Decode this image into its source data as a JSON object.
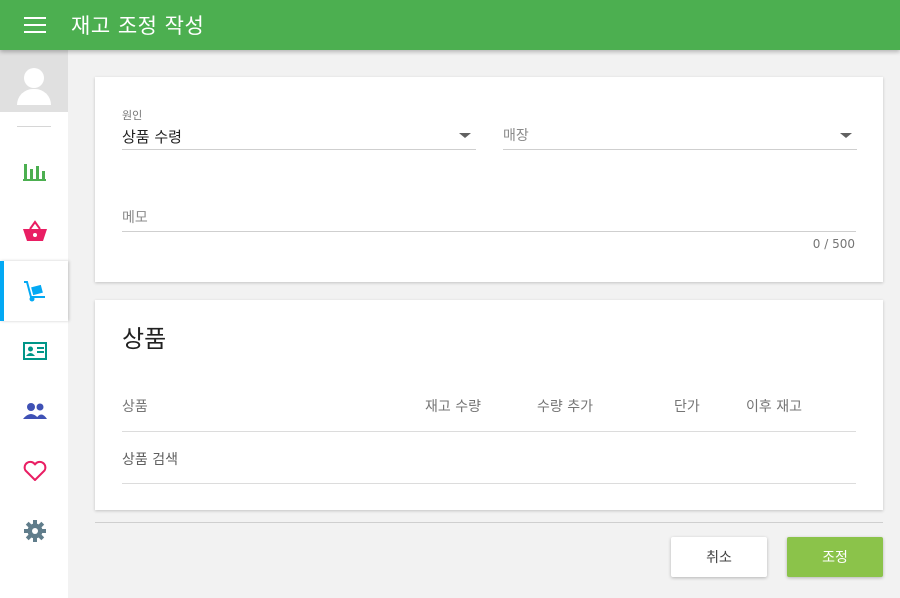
{
  "header": {
    "title": "재고 조정 작성",
    "menu_icon": "hamburger-menu-icon"
  },
  "sidebar": {
    "avatar_icon": "user-avatar-icon",
    "items": [
      {
        "name": "sales-report",
        "icon": "bar-chart-icon",
        "color": "#4caf50",
        "active": false
      },
      {
        "name": "sales",
        "icon": "basket-icon",
        "color": "#e91e63",
        "active": false
      },
      {
        "name": "inventory",
        "icon": "hand-truck-icon",
        "color": "#03a9f4",
        "active": true
      },
      {
        "name": "products",
        "icon": "id-card-icon",
        "color": "#009688",
        "active": false
      },
      {
        "name": "customers",
        "icon": "people-icon",
        "color": "#3f51b5",
        "active": false
      },
      {
        "name": "favorites",
        "icon": "heart-icon",
        "color": "#e91e63",
        "active": false
      },
      {
        "name": "settings",
        "icon": "gear-icon",
        "color": "#607d8b",
        "active": false
      }
    ]
  },
  "form": {
    "reason": {
      "label": "원인",
      "value": "상품 수령"
    },
    "store": {
      "placeholder": "매장"
    },
    "memo": {
      "placeholder": "메모",
      "counter": "0 / 500"
    }
  },
  "products": {
    "title": "상품",
    "columns": [
      "상품",
      "재고 수량",
      "수량 추가",
      "단가",
      "이후 재고"
    ],
    "search_placeholder": "상품 검색"
  },
  "actions": {
    "cancel": "취소",
    "submit": "조정"
  },
  "colors": {
    "header": "#4caf50",
    "active_indicator": "#03a9f4",
    "submit_button": "#8bc34a"
  }
}
